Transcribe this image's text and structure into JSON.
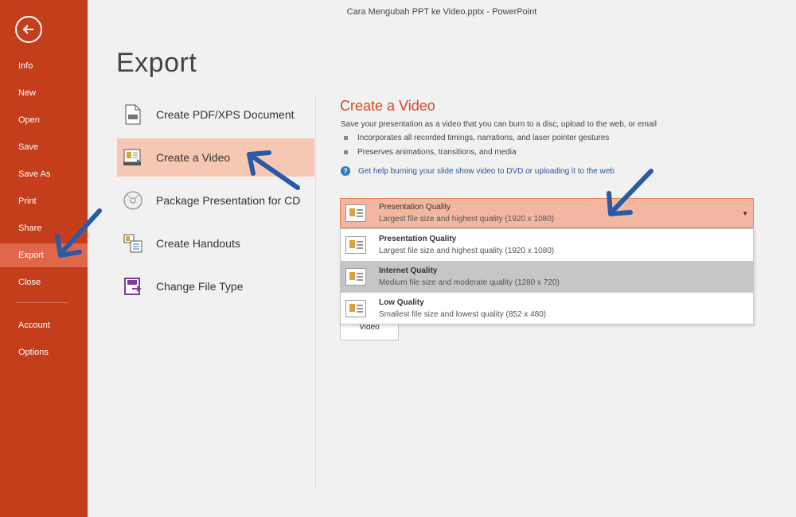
{
  "window_title": "Cara Mengubah PPT ke Video.pptx - PowerPoint",
  "sidebar": {
    "items": [
      {
        "label": "Info"
      },
      {
        "label": "New"
      },
      {
        "label": "Open"
      },
      {
        "label": "Save"
      },
      {
        "label": "Save As"
      },
      {
        "label": "Print"
      },
      {
        "label": "Share"
      },
      {
        "label": "Export",
        "active": true
      },
      {
        "label": "Close"
      },
      {
        "label": "Account"
      },
      {
        "label": "Options"
      }
    ]
  },
  "page_title": "Export",
  "export_options": [
    {
      "label": "Create PDF/XPS Document",
      "icon": "pdf-document-icon"
    },
    {
      "label": "Create a Video",
      "icon": "video-icon",
      "selected": true
    },
    {
      "label": "Package Presentation for CD",
      "icon": "cd-icon"
    },
    {
      "label": "Create Handouts",
      "icon": "handouts-icon"
    },
    {
      "label": "Change File Type",
      "icon": "file-type-icon"
    }
  ],
  "panel": {
    "title": "Create a Video",
    "description": "Save your presentation as a video that you can burn to a disc, upload to the web, or email",
    "bullets": [
      "Incorporates all recorded timings, narrations, and laser pointer gestures",
      "Preserves animations, transitions, and media"
    ],
    "help_link": "Get help burning your slide show video to DVD or uploading it to the web",
    "quality_select": {
      "title": "Presentation Quality",
      "subtitle": "Largest file size and highest quality (1920 x 1080)"
    },
    "quality_options": [
      {
        "title": "Presentation Quality",
        "subtitle": "Largest file size and highest quality (1920 x 1080)"
      },
      {
        "title": "Internet Quality",
        "subtitle": "Medium file size and moderate quality (1280 x 720)",
        "highlighted": true
      },
      {
        "title": "Low Quality",
        "subtitle": "Smallest file size and lowest quality (852 x 480)"
      }
    ],
    "video_button": "Video"
  },
  "colors": {
    "sidebar_bg": "#c43e1c",
    "sidebar_active": "#e1674a",
    "accent_title": "#d24726",
    "selected_option_bg": "#f6c8b3",
    "annotation_arrow": "#2a5aa6"
  }
}
